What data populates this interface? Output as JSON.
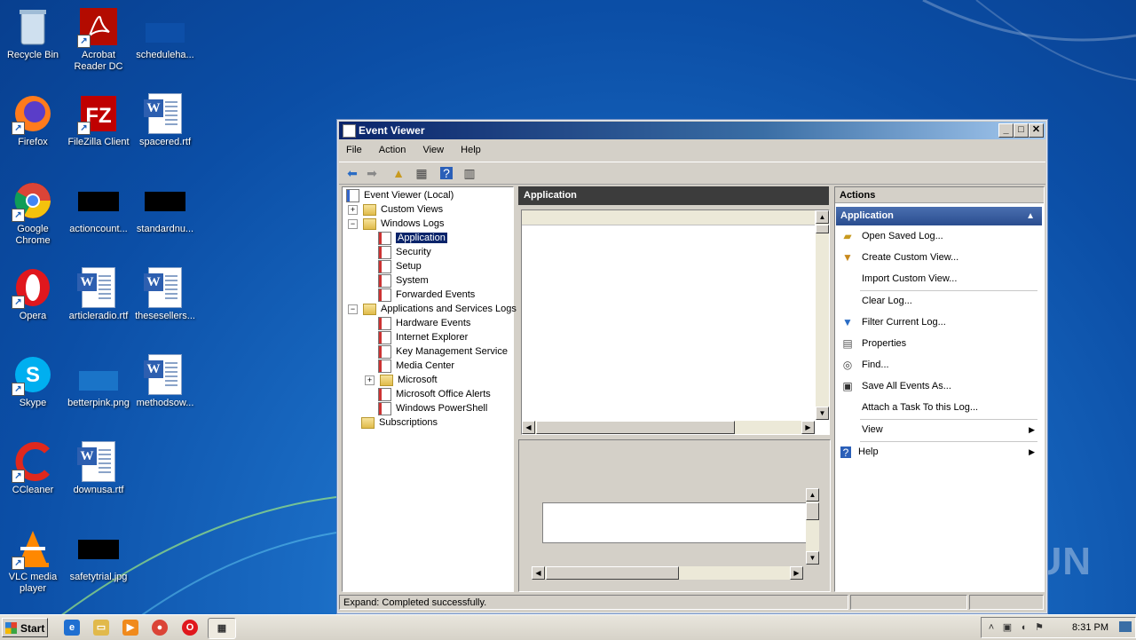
{
  "desktop": {
    "icons": [
      {
        "label": "Recycle Bin"
      },
      {
        "label": "Acrobat Reader DC"
      },
      {
        "label": "scheduleha..."
      },
      {
        "label": "Firefox"
      },
      {
        "label": "FileZilla Client"
      },
      {
        "label": "spacered.rtf"
      },
      {
        "label": "Google Chrome"
      },
      {
        "label": "actioncount..."
      },
      {
        "label": "standardnu..."
      },
      {
        "label": "Opera"
      },
      {
        "label": "articleradio.rtf"
      },
      {
        "label": "thesesellers..."
      },
      {
        "label": "Skype"
      },
      {
        "label": "betterpink.png"
      },
      {
        "label": "methodsow..."
      },
      {
        "label": "CCleaner"
      },
      {
        "label": "downusa.rtf"
      },
      {
        "label": "VLC media player"
      },
      {
        "label": "safetytrial.jpg"
      }
    ],
    "watermark": "ANY RUN"
  },
  "window": {
    "title": "Event Viewer",
    "controls": {
      "minimize": "_",
      "maximize": "□",
      "close": "✕"
    },
    "menu": [
      "File",
      "Action",
      "View",
      "Help"
    ],
    "tree": {
      "root": "Event Viewer (Local)",
      "custom_views": "Custom Views",
      "windows_logs": "Windows Logs",
      "logs": [
        "Application",
        "Security",
        "Setup",
        "System",
        "Forwarded Events"
      ],
      "app_services": "Applications and Services Logs",
      "app_logs": [
        "Hardware Events",
        "Internet Explorer",
        "Key Management Service",
        "Media Center",
        "Microsoft",
        "Microsoft Office Alerts",
        "Windows PowerShell"
      ],
      "subscriptions": "Subscriptions"
    },
    "center_title": "Application",
    "actions": {
      "header": "Actions",
      "section": "Application",
      "items": [
        "Open Saved Log...",
        "Create Custom View...",
        "Import Custom View...",
        "Clear Log...",
        "Filter Current Log...",
        "Properties",
        "Find...",
        "Save All Events As...",
        "Attach a Task To this Log...",
        "View",
        "Help"
      ]
    },
    "status": "Expand:  Completed successfully."
  },
  "taskbar": {
    "start": "Start",
    "clock": "8:31 PM"
  }
}
